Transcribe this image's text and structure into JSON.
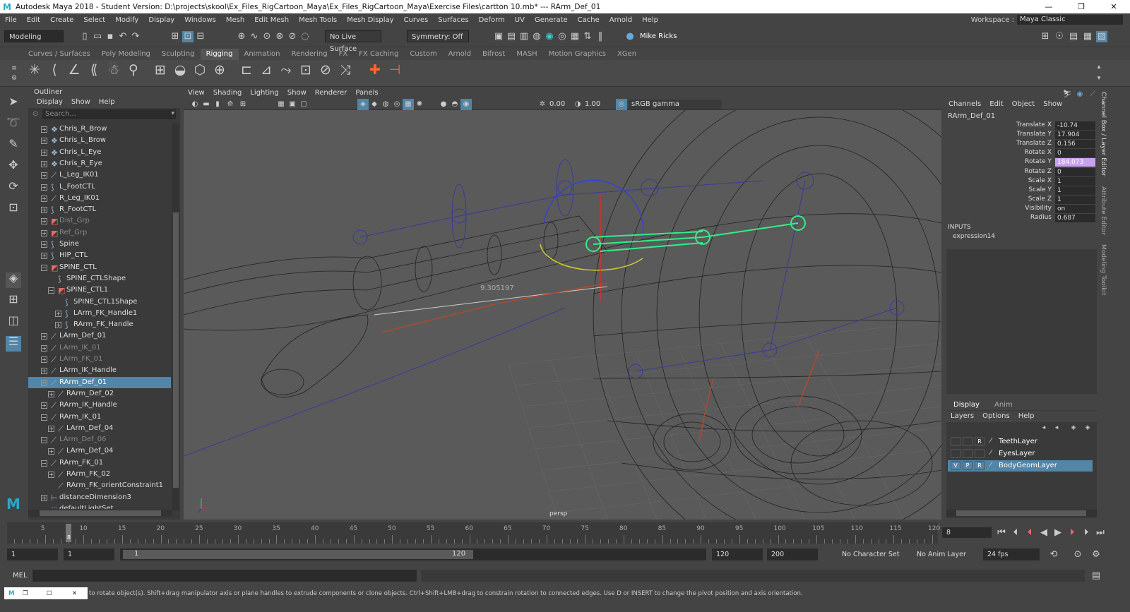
{
  "app": {
    "title": "Autodesk Maya 2018 - Student Version: D:\\projects\\skool\\Ex_Files_RigCartoon_Maya\\Ex_Files_RigCartoon_Maya\\Exercise Files\\cartton 10.mb*   ---   RArm_Def_01",
    "min": "—",
    "max": "❐",
    "close": "✕"
  },
  "menubar": [
    "File",
    "Edit",
    "Create",
    "Select",
    "Modify",
    "Display",
    "Windows",
    "Mesh",
    "Edit Mesh",
    "Mesh Tools",
    "Mesh Display",
    "Curves",
    "Surfaces",
    "Deform",
    "UV",
    "Generate",
    "Cache",
    "Arnold",
    "Help"
  ],
  "workspace": {
    "label": "Workspace :",
    "value": "Maya Classic"
  },
  "status": {
    "menuset": "Modeling",
    "live": "No Live Surface",
    "symmetry": "Symmetry: Off",
    "user": "Mike Ricks"
  },
  "shelf_tabs": [
    "Curves / Surfaces",
    "Poly Modeling",
    "Sculpting",
    "Rigging",
    "Animation",
    "Rendering",
    "FX",
    "FX Caching",
    "Custom",
    "Arnold",
    "Bifrost",
    "MASH",
    "Motion Graphics",
    "XGen"
  ],
  "shelf_active": "Rigging",
  "outliner": {
    "title": "Outliner",
    "menus": [
      "Display",
      "Show",
      "Help"
    ],
    "search": "Search...",
    "rows": [
      {
        "label": "Chris_R_Brow",
        "ind": 0,
        "ex": "+",
        "icon": "❖",
        "dim": false
      },
      {
        "label": "Chris_L_Brow",
        "ind": 0,
        "ex": "+",
        "icon": "❖",
        "dim": false
      },
      {
        "label": "Chris_L_Eye",
        "ind": 0,
        "ex": "+",
        "icon": "❖",
        "dim": false
      },
      {
        "label": "Chris_R_Eye",
        "ind": 0,
        "ex": "+",
        "icon": "❖",
        "dim": false
      },
      {
        "label": "L_Leg_IK01",
        "ind": 0,
        "ex": "+",
        "icon": "⟋",
        "dim": false
      },
      {
        "label": "L_FootCTL",
        "ind": 0,
        "ex": "+",
        "icon": "⟆",
        "dim": false
      },
      {
        "label": "R_Leg_IK01",
        "ind": 0,
        "ex": "+",
        "icon": "⟋",
        "dim": false
      },
      {
        "label": "R_FootCTL",
        "ind": 0,
        "ex": "+",
        "icon": "⟆",
        "dim": false
      },
      {
        "label": "Dist_Grp",
        "ind": 0,
        "ex": "+",
        "icon": "◩",
        "dim": true
      },
      {
        "label": "Ref_Grp",
        "ind": 0,
        "ex": "+",
        "icon": "◩",
        "dim": true
      },
      {
        "label": "Spine",
        "ind": 0,
        "ex": "+",
        "icon": "⟆",
        "dim": false
      },
      {
        "label": "HIP_CTL",
        "ind": 0,
        "ex": "+",
        "icon": "⟆",
        "dim": false
      },
      {
        "label": "SPINE_CTL",
        "ind": 0,
        "ex": "−",
        "icon": "◩",
        "dim": false
      },
      {
        "label": "SPINE_CTLShape",
        "ind": 1,
        "ex": "",
        "icon": "⟆",
        "dim": false
      },
      {
        "label": "SPINE_CTL1",
        "ind": 1,
        "ex": "−",
        "icon": "◩",
        "dim": false
      },
      {
        "label": "SPINE_CTL1Shape",
        "ind": 2,
        "ex": "",
        "icon": "⟆",
        "dim": false
      },
      {
        "label": "LArm_FK_Handle1",
        "ind": 2,
        "ex": "+",
        "icon": "⟆",
        "dim": false
      },
      {
        "label": "RArm_FK_Handle",
        "ind": 2,
        "ex": "+",
        "icon": "⟆",
        "dim": false
      },
      {
        "label": "LArm_Def_01",
        "ind": 0,
        "ex": "+",
        "icon": "⟋",
        "dim": false
      },
      {
        "label": "LArm_IK_01",
        "ind": 0,
        "ex": "+",
        "icon": "⟋",
        "dim": true
      },
      {
        "label": "LArm_FK_01",
        "ind": 0,
        "ex": "+",
        "icon": "⟋",
        "dim": true
      },
      {
        "label": "LArm_IK_Handle",
        "ind": 0,
        "ex": "+",
        "icon": "⟋",
        "dim": false
      },
      {
        "label": "RArm_Def_01",
        "ind": 0,
        "ex": "−",
        "icon": "⟋",
        "dim": false,
        "sel": true
      },
      {
        "label": "RArm_Def_02",
        "ind": 1,
        "ex": "+",
        "icon": "⟋",
        "dim": false
      },
      {
        "label": "RArm_IK_Handle",
        "ind": 0,
        "ex": "+",
        "icon": "⟋",
        "dim": false
      },
      {
        "label": "RArm_IK_01",
        "ind": 0,
        "ex": "−",
        "icon": "⟋",
        "dim": false
      },
      {
        "label": "LArm_Def_04",
        "ind": 1,
        "ex": "+",
        "icon": "⟋",
        "dim": false
      },
      {
        "label": "LArm_Def_06",
        "ind": 0,
        "ex": "−",
        "icon": "⟋",
        "dim": true
      },
      {
        "label": "LArm_Def_04",
        "ind": 1,
        "ex": "+",
        "icon": "⟋",
        "dim": false
      },
      {
        "label": "RArm_FK_01",
        "ind": 0,
        "ex": "−",
        "icon": "⟋",
        "dim": false
      },
      {
        "label": "RArm_FK_02",
        "ind": 1,
        "ex": "+",
        "icon": "⟋",
        "dim": false
      },
      {
        "label": "RArm_FK_orientConstraint1",
        "ind": 1,
        "ex": "",
        "icon": "⟋",
        "dim": false
      },
      {
        "label": "distanceDimension3",
        "ind": 0,
        "ex": "+",
        "icon": "⊢",
        "dim": false
      },
      {
        "label": "defaultLightSet",
        "ind": 0,
        "ex": "",
        "icon": "◌",
        "dim": false
      }
    ]
  },
  "viewport": {
    "menus": [
      "View",
      "Shading",
      "Lighting",
      "Show",
      "Renderer",
      "Panels"
    ],
    "exposure": "0.00",
    "gamma": "1.00",
    "colorspace": "sRGB gamma",
    "camera": "persp",
    "distance": "9.305197"
  },
  "channel": {
    "menus": [
      "Channels",
      "Edit",
      "Object",
      "Show"
    ],
    "node": "RArm_Def_01",
    "attrs": [
      {
        "name": "Translate X",
        "value": "-10.74",
        "hi": false
      },
      {
        "name": "Translate Y",
        "value": "17.904",
        "hi": false
      },
      {
        "name": "Translate Z",
        "value": "0.156",
        "hi": false
      },
      {
        "name": "Rotate X",
        "value": "0",
        "hi": false
      },
      {
        "name": "Rotate Y",
        "value": "184.073",
        "hi": true
      },
      {
        "name": "Rotate Z",
        "value": "0",
        "hi": false
      },
      {
        "name": "Scale X",
        "value": "1",
        "hi": false
      },
      {
        "name": "Scale Y",
        "value": "1",
        "hi": false
      },
      {
        "name": "Scale Z",
        "value": "1",
        "hi": false
      },
      {
        "name": "Visibility",
        "value": "on",
        "hi": false
      },
      {
        "name": "Radius",
        "value": "0.687",
        "hi": false
      }
    ],
    "inputs": "INPUTS",
    "expression": "expression14"
  },
  "layers": {
    "tabs": [
      "Display",
      "Anim"
    ],
    "menus": [
      "Layers",
      "Options",
      "Help"
    ],
    "items": [
      {
        "name": "TeethLayer",
        "v": "",
        "p": "",
        "r": "R",
        "sel": false
      },
      {
        "name": "EyesLayer",
        "v": "",
        "p": "",
        "r": "",
        "sel": false
      },
      {
        "name": "BodyGeomLayer",
        "v": "V",
        "p": "P",
        "r": "R",
        "sel": true
      }
    ]
  },
  "sidetabs": [
    "Channel Box / Layer Editor",
    "Attribute Editor",
    "Modeling Toolkit"
  ],
  "timeline": {
    "ticks": [
      "5",
      "10",
      "15",
      "20",
      "25",
      "30",
      "35",
      "40",
      "45",
      "50",
      "55",
      "60",
      "65",
      "70",
      "75",
      "80",
      "85",
      "90",
      "95",
      "100",
      "105",
      "110",
      "115",
      "120"
    ],
    "current": "8",
    "current_field": "8"
  },
  "range": {
    "start": "1",
    "startb": "1",
    "slider_start": "1",
    "slider_end": "120",
    "end": "120",
    "endb": "200",
    "charset": "No Character Set",
    "animlayer": "No Anim Layer",
    "fps": "24 fps"
  },
  "cmd": {
    "label": "MEL"
  },
  "help": "to rotate object(s). Shift+drag manipulator axis or plane handles to extrude components or clone objects. Ctrl+Shift+LMB+drag to constrain rotation to connected edges. Use D or INSERT to change the pivot position and axis orientation."
}
